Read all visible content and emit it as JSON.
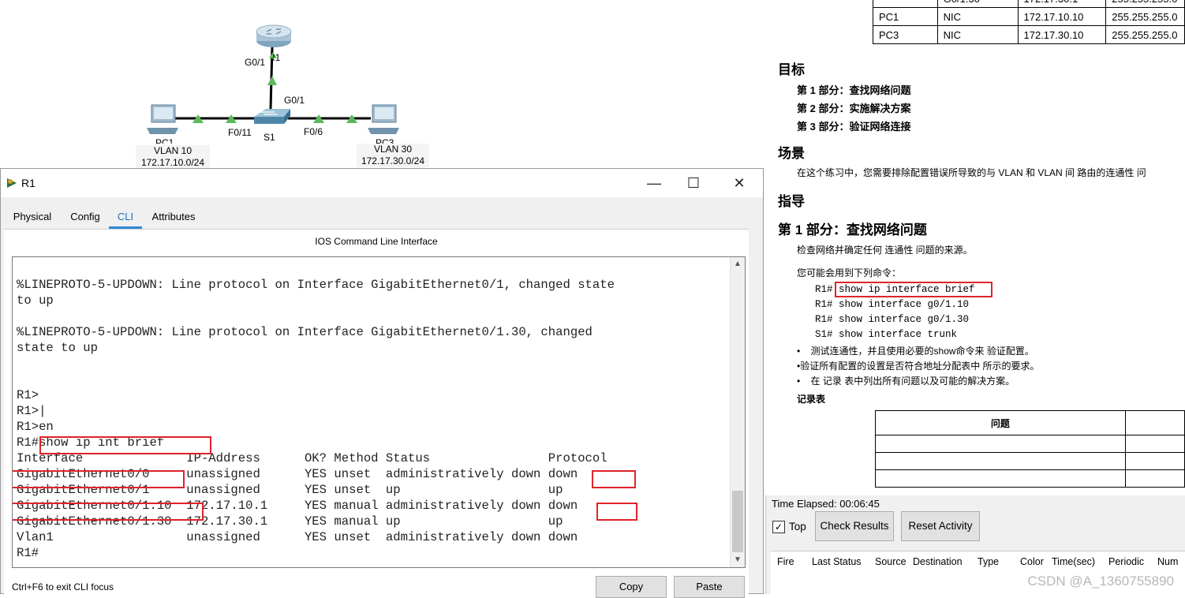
{
  "topology": {
    "router_port": "G0/1",
    "router_name_partial": "R1",
    "switch_uplink": "G0/1",
    "switch_name": "S1",
    "switch_port_left": "F0/11",
    "switch_port_right": "F0/6",
    "pc_left_name_partial": "PC1",
    "pc_right_name_partial": "PC3",
    "vlan_left": "VLAN 10",
    "subnet_left": "172.17.10.0/24",
    "vlan_right": "VLAN 30",
    "subnet_right": "172.17.30.0/24",
    "link_color": "#5cb85c"
  },
  "window": {
    "title": "R1",
    "tabs": [
      "Physical",
      "Config",
      "CLI",
      "Attributes"
    ],
    "active_tab": "CLI",
    "cli_header": "IOS Command Line Interface",
    "cli_lines": [
      "",
      "%LINEPROTO-5-UPDOWN: Line protocol on Interface GigabitEthernet0/1, changed state",
      "to up",
      "",
      "%LINEPROTO-5-UPDOWN: Line protocol on Interface GigabitEthernet0/1.30, changed",
      "state to up",
      "",
      "",
      "R1>",
      "R1>|",
      "R1>en",
      "R1#show ip int brief",
      "Interface              IP-Address      OK? Method Status                Protocol",
      "GigabitEthernet0/0     unassigned      YES unset  administratively down down",
      "GigabitEthernet0/1     unassigned      YES unset  up                    up",
      "GigabitEthernet0/1.10  172.17.10.1     YES manual administratively down down",
      "GigabitEthernet0/1.30  172.17.30.1     YES manual up                    up",
      "Vlan1                  unassigned      YES unset  administratively down down",
      "R1#"
    ],
    "hint": "Ctrl+F6 to exit CLI focus",
    "copy_label": "Copy",
    "paste_label": "Paste",
    "highlight_color": "#e0232a"
  },
  "instructions": {
    "addr_rows": [
      [
        "",
        "G0/1.30",
        "172.17.30.1",
        "255.255.255.0"
      ],
      [
        "PC1",
        "NIC",
        "172.17.10.10",
        "255.255.255.0"
      ],
      [
        "PC3",
        "NIC",
        "172.17.30.10",
        "255.255.255.0"
      ]
    ],
    "objectives_heading": "目标",
    "objectives": [
      "第 1 部分：查找网络问题",
      "第 2 部分：实施解决方案",
      "第 3 部分：验证网络连接"
    ],
    "scenario_heading": "场景",
    "scenario_text": "在这个练习中，您需要排除配置错误所导致的与 VLAN 和 VLAN 间 路由的连通性 问",
    "guide_heading": "指导",
    "part1_heading": "第 1 部分：查找网络问题",
    "part1_text": "检查网络并确定任何 连通性 问题的来源。",
    "commands_intro": "您可能会用到下列命令：",
    "commands": [
      [
        "R1#",
        "show ip interface brief"
      ],
      [
        "R1#",
        "show interface g0/1.10"
      ],
      [
        "R1#",
        "show interface g0/1.30"
      ],
      [
        "S1#",
        "show interface trunk"
      ]
    ],
    "bullet1": "测试连通性，并且使用必要的show命令来 验证配置。",
    "bullet2": "验证所有配置的设置是否符合地址分配表中 所示的要求。",
    "bullet3": "在 记录 表中列出所有问题以及可能的解决方案。",
    "record_heading": "记录表",
    "record_col": "问题"
  },
  "sim": {
    "elapsed": "Time Elapsed: 00:06:45",
    "top_label": "Top",
    "top_checked": true,
    "check_results": "Check Results",
    "reset_activity": "Reset Activity",
    "event_headers": [
      "Fire",
      "Last Status",
      "Source",
      "Destination",
      "Type",
      "Color",
      "Time(sec)",
      "Periodic",
      "Num"
    ]
  },
  "watermark": "CSDN @A_1360755890"
}
